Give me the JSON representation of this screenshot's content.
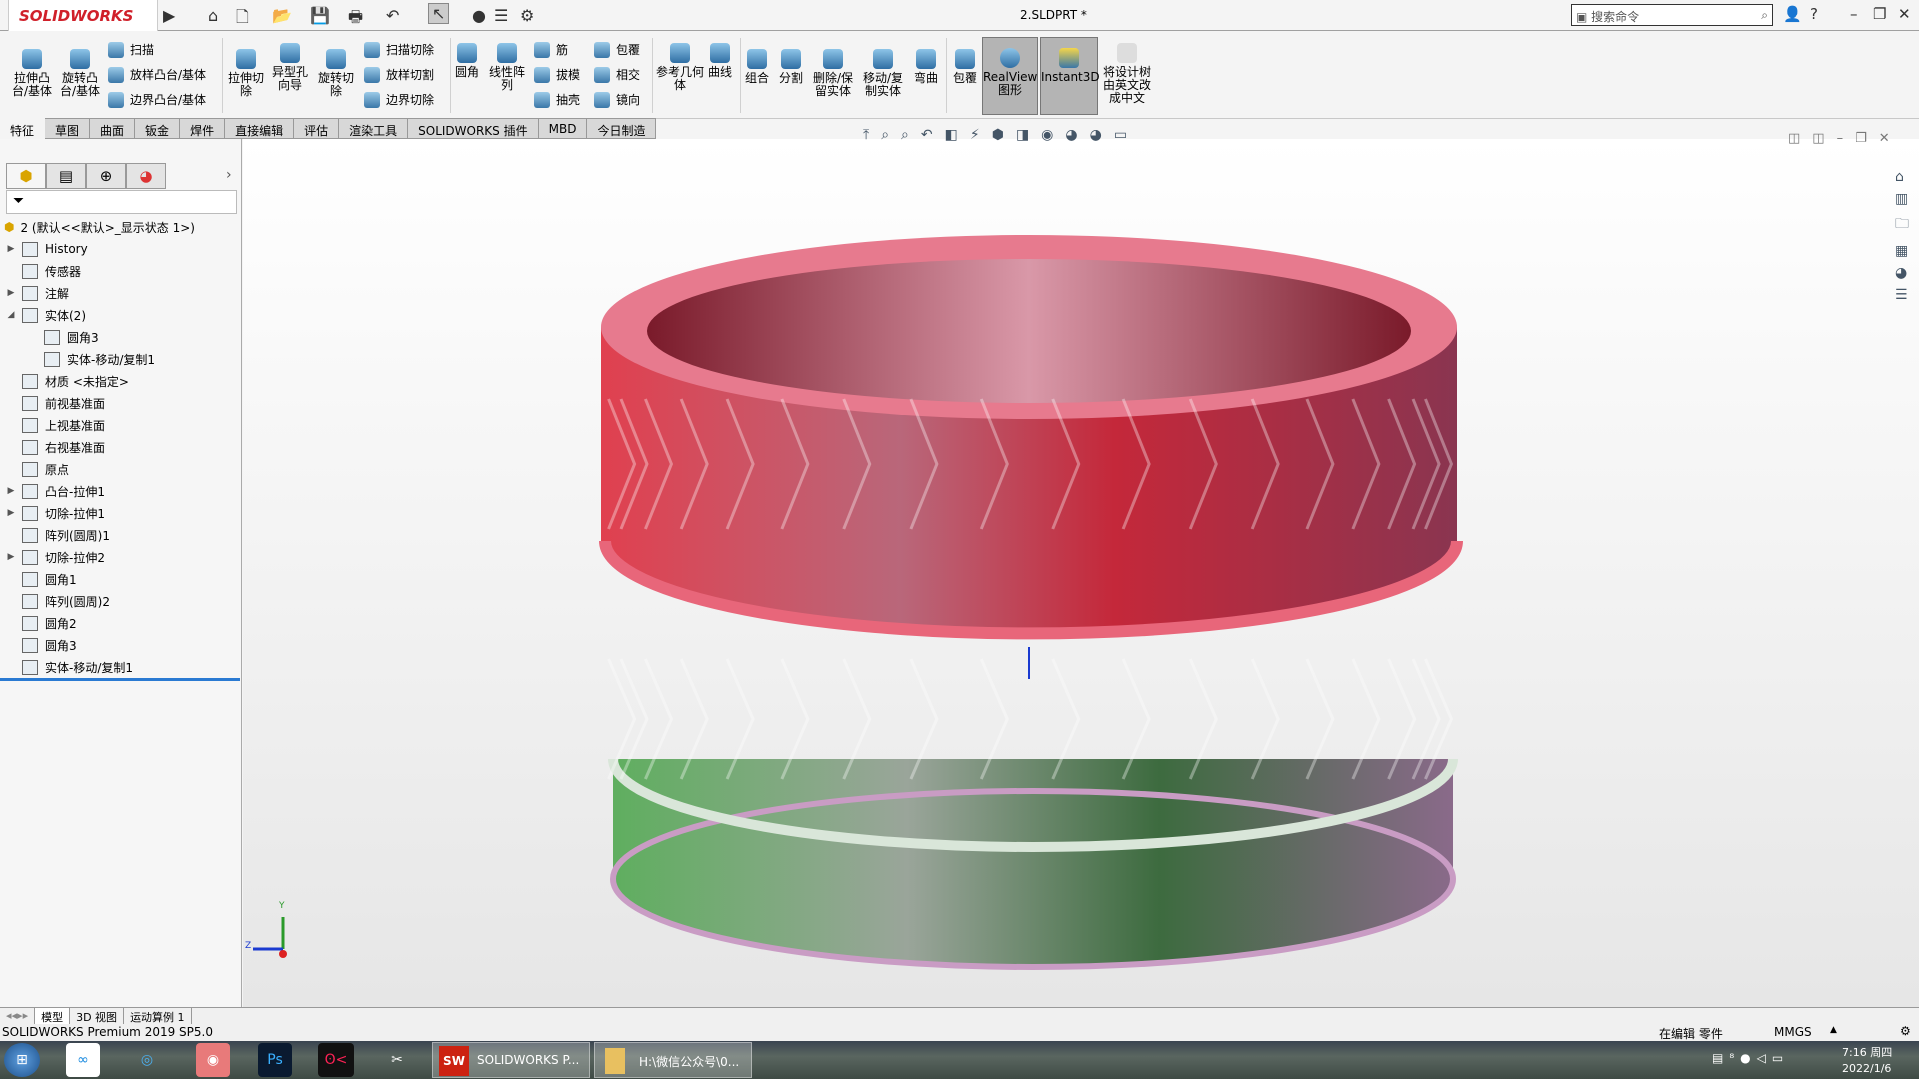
{
  "app": {
    "logo": "SOLIDWORKS",
    "title": "2.SLDPRT *",
    "search_placeholder": "搜索命令"
  },
  "ribbon": {
    "big": [
      "拉伸凸台/基体",
      "旋转凸台/基体",
      "拉伸切除",
      "异型孔向导",
      "旋转切除",
      "圆角",
      "线性阵列",
      "参考几何体",
      "曲线",
      "组合",
      "分割",
      "删除/保留实体",
      "移动/复制实体",
      "弯曲",
      "包覆",
      "RealView 图形",
      "Instant3D",
      "将设计树由英文改成中文"
    ],
    "small": [
      "扫描",
      "放样凸台/基体",
      "边界凸台/基体",
      "扫描切除",
      "放样切割",
      "边界切除",
      "筋",
      "拔模",
      "抽壳",
      "包覆",
      "相交",
      "镜向"
    ]
  },
  "tabs": [
    "特征",
    "草图",
    "曲面",
    "钣金",
    "焊件",
    "直接编辑",
    "评估",
    "渲染工具",
    "SOLIDWORKS 插件",
    "MBD",
    "今日制造"
  ],
  "tree": {
    "root": "2  (默认<<默认>_显示状态 1>)",
    "items": [
      "History",
      "传感器",
      "注解",
      "实体(2)",
      "圆角3",
      "实体-移动/复制1",
      "材质 <未指定>",
      "前视基准面",
      "上视基准面",
      "右视基准面",
      "原点",
      "凸台-拉伸1",
      "切除-拉伸1",
      "阵列(圆周)1",
      "切除-拉伸2",
      "圆角1",
      "阵列(圆周)2",
      "圆角2",
      "圆角3",
      "实体-移动/复制1"
    ]
  },
  "bottom_tabs": [
    "模型",
    "3D 视图",
    "运动算例 1"
  ],
  "status": {
    "left": "SOLIDWORKS Premium 2019 SP5.0",
    "mode": "在编辑 零件",
    "units": "MMGS"
  },
  "taskbar": {
    "windows": [
      "SOLIDWORKS P...",
      "H:\\微信公众号\\0..."
    ],
    "time": "7:16 周四",
    "date": "2022/1/6"
  },
  "triad": {
    "y": "Y",
    "z": "Z"
  },
  "colors": {
    "top_body": "#c8283a",
    "bottom_body": "#4f8f4f"
  }
}
